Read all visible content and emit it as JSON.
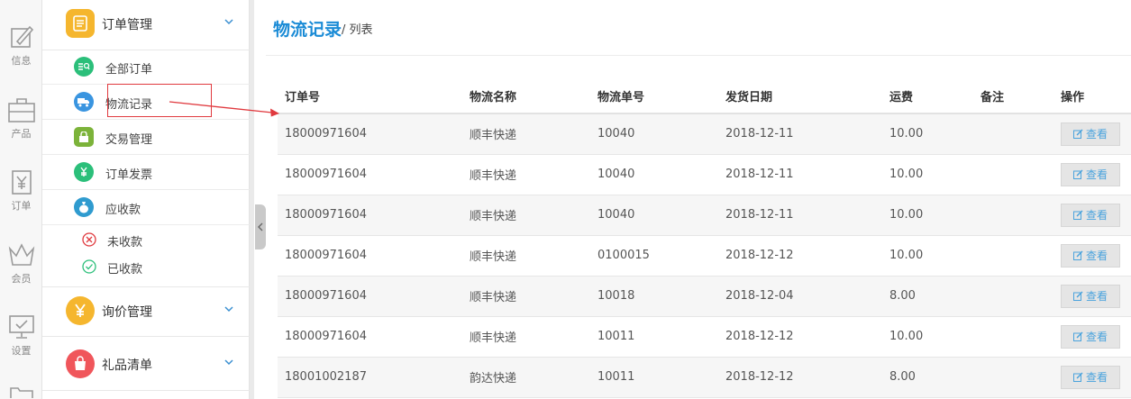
{
  "rail": [
    {
      "label": "信息",
      "icon": "edit-icon"
    },
    {
      "label": "产品",
      "icon": "briefcase-icon"
    },
    {
      "label": "订单",
      "icon": "yen-clipboard-icon"
    },
    {
      "label": "会员",
      "icon": "crown-icon"
    },
    {
      "label": "设置",
      "icon": "monitor-check-icon"
    }
  ],
  "menu": {
    "order_group": "订单管理",
    "order_items": [
      "全部订单",
      "物流记录",
      "交易管理",
      "订单发票",
      "应收款"
    ],
    "receivable_items": [
      "未收款",
      "已收款"
    ],
    "inquiry_group": "询价管理",
    "gift_group": "礼品清单"
  },
  "header": {
    "title": "物流记录",
    "crumb": "/ 列表"
  },
  "table": {
    "columns": [
      "订单号",
      "物流名称",
      "物流单号",
      "发货日期",
      "运费",
      "备注",
      "操作"
    ],
    "view_label": "查看",
    "rows": [
      {
        "order": "18000971604",
        "carrier": "顺丰快递",
        "tracking": "10040",
        "date": "2018-12-11",
        "fee": "10.00",
        "note": ""
      },
      {
        "order": "18000971604",
        "carrier": "顺丰快递",
        "tracking": "10040",
        "date": "2018-12-11",
        "fee": "10.00",
        "note": ""
      },
      {
        "order": "18000971604",
        "carrier": "顺丰快递",
        "tracking": "10040",
        "date": "2018-12-11",
        "fee": "10.00",
        "note": ""
      },
      {
        "order": "18000971604",
        "carrier": "顺丰快递",
        "tracking": "0100015",
        "date": "2018-12-12",
        "fee": "10.00",
        "note": ""
      },
      {
        "order": "18000971604",
        "carrier": "顺丰快递",
        "tracking": "10018",
        "date": "2018-12-04",
        "fee": "8.00",
        "note": ""
      },
      {
        "order": "18000971604",
        "carrier": "顺丰快递",
        "tracking": "10011",
        "date": "2018-12-12",
        "fee": "10.00",
        "note": ""
      },
      {
        "order": "18001002187",
        "carrier": "韵达快递",
        "tracking": "10011",
        "date": "2018-12-12",
        "fee": "8.00",
        "note": ""
      }
    ]
  },
  "colors": {
    "accent": "#1a8bd6",
    "highlight": "#e0393e",
    "view_text": "#4aa3dd"
  }
}
